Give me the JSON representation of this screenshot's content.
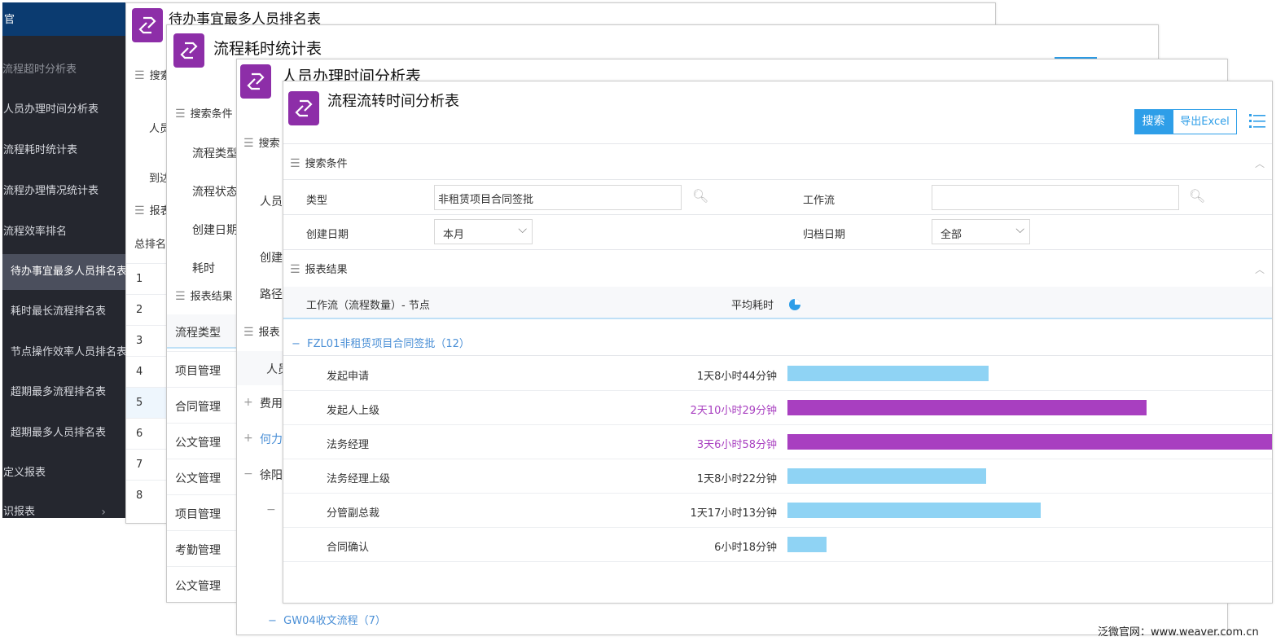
{
  "sidebar": {
    "top_label": "官",
    "cut_item": "流程超时分析表",
    "items": [
      {
        "label": "人员办理时间分析表",
        "sub": false,
        "active": false
      },
      {
        "label": "流程耗时统计表",
        "sub": false,
        "active": false
      },
      {
        "label": "流程办理情况统计表",
        "sub": false,
        "active": false
      },
      {
        "label": "流程效率排名",
        "sub": false,
        "active": false
      },
      {
        "label": "待办事宜最多人员排名表",
        "sub": true,
        "active": true
      },
      {
        "label": "耗时最长流程排名表",
        "sub": true,
        "active": false
      },
      {
        "label": "节点操作效率人员排名表",
        "sub": true,
        "active": false
      },
      {
        "label": "超期最多流程排名表",
        "sub": true,
        "active": false
      },
      {
        "label": "超期最多人员排名表",
        "sub": true,
        "active": false
      },
      {
        "label": "定义报表",
        "sub": false,
        "active": false
      },
      {
        "label": "识报表",
        "sub": false,
        "active": false
      }
    ]
  },
  "win1": {
    "title": "待办事宜最多人员排名表",
    "search_label": "搜索",
    "person_label": "人员",
    "arrive_label": "到达",
    "report_label": "报表",
    "rank_header": "总排名",
    "ranks": [
      "1",
      "2",
      "3",
      "4",
      "5",
      "6",
      "7",
      "8"
    ]
  },
  "win2": {
    "title": "流程耗时统计表",
    "search_label": "搜索条件",
    "fields": [
      "流程类型",
      "流程状态",
      "创建日期",
      "耗时"
    ],
    "report_label": "报表结果",
    "col_header": "流程类型",
    "types": [
      "项目管理",
      "合同管理",
      "公文管理",
      "公文管理",
      "项目管理",
      "考勤管理",
      "公文管理"
    ]
  },
  "win3": {
    "title": "人员办理时间分析表",
    "search_label": "搜索",
    "person_label": "人员",
    "create_label": "创建",
    "path_label": "路径",
    "report_label": "报表",
    "col_header": "人员",
    "group_row": "GW04收文流程（7）",
    "row_names": [
      "费用",
      "何力",
      "徐阳"
    ]
  },
  "win4": {
    "title": "流程流转时间分析表",
    "btn_search": "搜索",
    "btn_export": "导出Excel",
    "search_section": "搜索条件",
    "type_label": "类型",
    "type_value": "非租赁项目合同签批",
    "workflow_label": "工作流",
    "workflow_value": "",
    "create_date_label": "创建日期",
    "create_date_value": "本月",
    "archive_date_label": "归档日期",
    "archive_date_value": "全部",
    "report_section": "报表结果",
    "col_workflow": "工作流（流程数量）- 节点",
    "col_avg": "平均耗时",
    "group": "FZL01非租赁项目合同签批（12）",
    "colors": {
      "normal": "#8fd3f4",
      "overtime": "#a83fc0",
      "overtime_text": "#a83fc0"
    }
  },
  "chart_data": {
    "type": "bar",
    "categories": [
      "发起申请",
      "发起人上级",
      "法务经理",
      "法务经理上级",
      "分管副总裁",
      "合同确认"
    ],
    "labels": [
      "1天8小时44分钟",
      "2天10小时29分钟",
      "3天6小时58分钟",
      "1天8小时22分钟",
      "1天17小时13分钟",
      "6小时18分钟"
    ],
    "values_minutes": [
      1964,
      3509,
      4738,
      1942,
      2473,
      378
    ],
    "highlight": [
      false,
      true,
      true,
      false,
      false,
      false
    ]
  },
  "footer": "泛微官网：www.weaver.com.cn"
}
